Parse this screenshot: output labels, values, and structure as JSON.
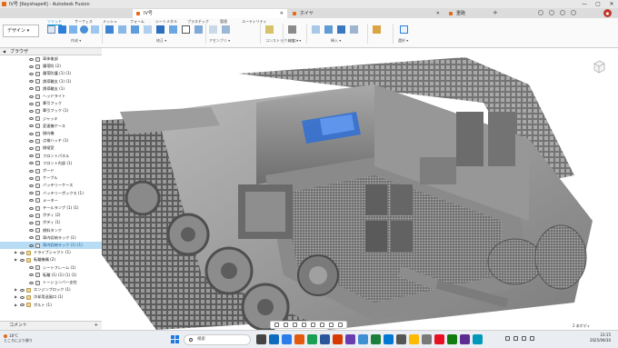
{
  "window": {
    "title": "IV号 [Keyshape4] - Autodesk Fusion",
    "controls": [
      "—",
      "▢",
      "✕"
    ]
  },
  "tabs": [
    {
      "label": "IV号",
      "active": true
    },
    {
      "label": "ホイヤ",
      "active": false
    },
    {
      "label": "重砲",
      "active": false
    }
  ],
  "ribbon": {
    "workspace": "デザイン ▾",
    "tabs": [
      "ソリッド",
      "サーフェス",
      "メッシュ",
      "フォーム",
      "シートメタル",
      "プラスチック",
      "管理",
      "ユーティリティ"
    ],
    "active_tab": "ソリッド",
    "groups": [
      "作成 ▾",
      "修正 ▾",
      "アセンブリ ▾",
      "コンストラクション ▾",
      "検査 ▾",
      "挿入 ▾",
      "選択 ▾"
    ]
  },
  "browser": {
    "title": "ブラウザ",
    "items": [
      {
        "label": "車体後部",
        "level": 2,
        "kind": "body"
      },
      {
        "label": "履帯防 (2)",
        "level": 2,
        "kind": "body"
      },
      {
        "label": "履帯防護 (1) (1)",
        "level": 2,
        "kind": "body"
      },
      {
        "label": "誘導輪支 (1) (1)",
        "level": 2,
        "kind": "body"
      },
      {
        "label": "誘導輪支 (1)",
        "level": 2,
        "kind": "body"
      },
      {
        "label": "ヘッドライト",
        "level": 2,
        "kind": "body"
      },
      {
        "label": "牽引フック",
        "level": 2,
        "kind": "body"
      },
      {
        "label": "牽引フック (1)",
        "level": 2,
        "kind": "body"
      },
      {
        "label": "ジャッキ",
        "level": 2,
        "kind": "body"
      },
      {
        "label": "変速機ケース",
        "level": 2,
        "kind": "body"
      },
      {
        "label": "操向機",
        "level": 2,
        "kind": "body"
      },
      {
        "label": "点検ハッチ (1)",
        "level": 2,
        "kind": "body"
      },
      {
        "label": "操縦室",
        "level": 2,
        "kind": "body"
      },
      {
        "label": "フロントパネル",
        "level": 2,
        "kind": "body"
      },
      {
        "label": "フロント内部 (1)",
        "level": 2,
        "kind": "body"
      },
      {
        "label": "ボード",
        "level": 2,
        "kind": "body"
      },
      {
        "label": "ケーブル",
        "level": 2,
        "kind": "body"
      },
      {
        "label": "バッテリーケース",
        "level": 2,
        "kind": "body"
      },
      {
        "label": "バッテリーボックス (1)",
        "level": 2,
        "kind": "body"
      },
      {
        "label": "メーター",
        "level": 2,
        "kind": "body"
      },
      {
        "label": "テールランプ (1) (1)",
        "level": 2,
        "kind": "body"
      },
      {
        "label": "ボディ (2)",
        "level": 2,
        "kind": "body"
      },
      {
        "label": "ボディ (1)",
        "level": 2,
        "kind": "body"
      },
      {
        "label": "燃料タンク",
        "level": 2,
        "kind": "body"
      },
      {
        "label": "車内収納ラック (1)",
        "level": 2,
        "kind": "body"
      },
      {
        "label": "車内収納ラック (1) (1)",
        "level": 2,
        "kind": "body",
        "selected": true
      },
      {
        "label": "ドライブシャフト (1)",
        "level": 1,
        "kind": "folder"
      },
      {
        "label": "転輪機構 (2)",
        "level": 1,
        "kind": "folder"
      },
      {
        "label": "シートフレーム (1)",
        "level": 2,
        "kind": "body"
      },
      {
        "label": "転輪 (1) (1) (1) (1)",
        "level": 2,
        "kind": "body"
      },
      {
        "label": "トーションバー支柱",
        "level": 2,
        "kind": "body"
      },
      {
        "label": "エンジンブロック (1)",
        "level": 1,
        "kind": "folder"
      },
      {
        "label": "冷却用送風口 (1)",
        "level": 1,
        "kind": "folder"
      },
      {
        "label": "ボルト (1)",
        "level": 1,
        "kind": "folder"
      }
    ]
  },
  "comments": {
    "label": "コメント",
    "add": "+"
  },
  "navbar_hint": "",
  "bottom_right": "2 本ボディ",
  "taskbar": {
    "weather_temp": "18°C",
    "weather_desc": "ところにより曇り",
    "search_placeholder": "検索",
    "app_colors": [
      "#444444",
      "#0f6cbd",
      "#2b7de9",
      "#e35a0f",
      "#1a9e55",
      "#2b579a",
      "#d83b01",
      "#6a3cb0",
      "#3f8fd2",
      "#1b7f3b",
      "#0078d4",
      "#555555",
      "#ffb900",
      "#7a7a7a",
      "#e81123",
      "#107c10",
      "#5c2d91",
      "#0099bc"
    ],
    "time": "23:15",
    "date": "2025/09/30"
  },
  "colors": {
    "accent": "#0696d7",
    "selection": "#2f6fd6",
    "fusion_orange": "#e46a13"
  }
}
